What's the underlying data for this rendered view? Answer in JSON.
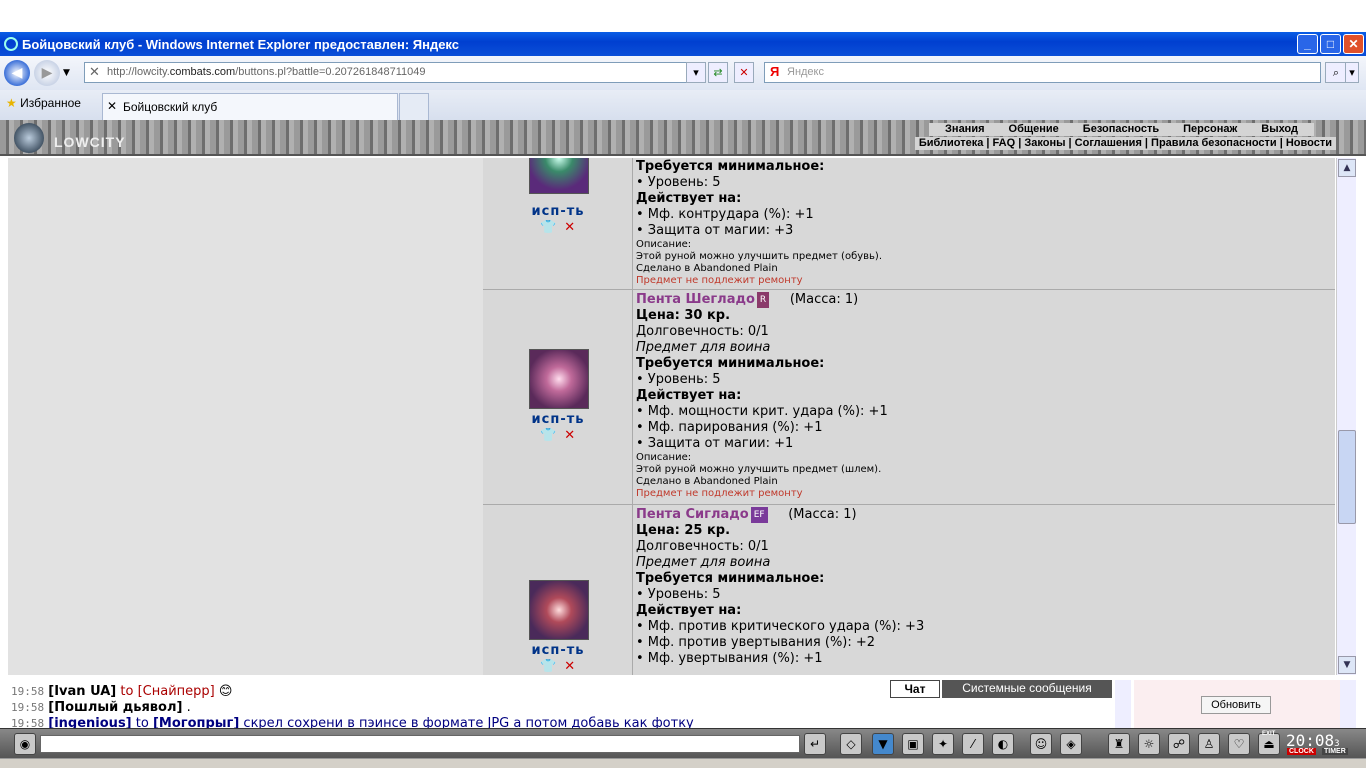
{
  "window": {
    "title": "Бойцовский клуб - Windows Internet Explorer предоставлен: Яндекс"
  },
  "address": {
    "prefix": "http://lowcity.",
    "domain": "combats.com",
    "path": "/buttons.pl?battle=0.207261848711049"
  },
  "search": {
    "placeholder": "Яндекс",
    "logo": "Я"
  },
  "tabs": {
    "favorites": "Избранное",
    "current": "Бойцовский клуб"
  },
  "game": {
    "logo": "LOWCITY",
    "menu_top": [
      "Знания",
      "Общение",
      "Безопасность",
      "Персонаж",
      "Выход"
    ],
    "menu_bottom": "Библиотека | FAQ | Законы | Соглашения | Правила безопасности | Новости"
  },
  "items": [
    {
      "use": "исп-ть",
      "req_title": "Требуется минимальное:",
      "level": "• Уровень: 5",
      "acts_title": "Действует на:",
      "effects": [
        "• Мф. контрудара (%): +1",
        "• Защита от магии: +3"
      ],
      "desc_title": "Описание:",
      "desc": "Этой руной можно улучшить предмет (обувь).",
      "made": "Сделано в Abandoned Plain",
      "repair": "Предмет не подлежит ремонту"
    },
    {
      "name": "Пента Шегладо",
      "badge": "R",
      "mass": "(Масса: 1)",
      "price": "Цена: 30 кр.",
      "durability": "Долговечность: 0/1",
      "for": "Предмет для воина",
      "req_title": "Требуется минимальное:",
      "level": "• Уровень: 5",
      "acts_title": "Действует на:",
      "effects": [
        "• Мф. мощности крит. удара (%): +1",
        "• Мф. парирования (%): +1",
        "• Защита от магии: +1"
      ],
      "desc_title": "Описание:",
      "desc": "Этой руной можно улучшить предмет (шлем).",
      "made": "Сделано в Abandoned Plain",
      "repair": "Предмет не подлежит ремонту",
      "use": "исп-ть"
    },
    {
      "name": "Пента Сигладо",
      "badge": "EF",
      "mass": "(Масса: 1)",
      "price": "Цена: 25 кр.",
      "durability": "Долговечность: 0/1",
      "for": "Предмет для воина",
      "req_title": "Требуется минимальное:",
      "level": "• Уровень: 5",
      "acts_title": "Действует на:",
      "effects": [
        "• Мф. против критического удара (%): +3",
        "• Мф. против увертывания (%): +2",
        "• Мф. увертывания (%): +1"
      ],
      "use": "исп-ть"
    }
  ],
  "chat": {
    "tab_chat": "Чат",
    "tab_system": "Системные сообщения",
    "lines": [
      {
        "time": "19:58",
        "from": "[Ivan UA]",
        "to": "to",
        "target": "[Снайперр]"
      },
      {
        "time": "19:58",
        "from": "[Пошлый дьявол]",
        "text": "."
      },
      {
        "time": "19:58",
        "from": "[ingenious]",
        "to": "to",
        "target": "[Могопрыг]",
        "text": "скрел сохрени в пэинсе в формате JPG а потом добавь как фотку"
      }
    ]
  },
  "right": {
    "refresh": "Обновить"
  },
  "clock": {
    "time": "20:08",
    "sec": "3",
    "clock_label": "CLOCK",
    "timer_label": "TIMER",
    "exit_label": "EXIT"
  },
  "colors": {
    "badge_r": "#8a3a6a",
    "badge_ef": "#7a3a9a",
    "link": "#003388"
  }
}
